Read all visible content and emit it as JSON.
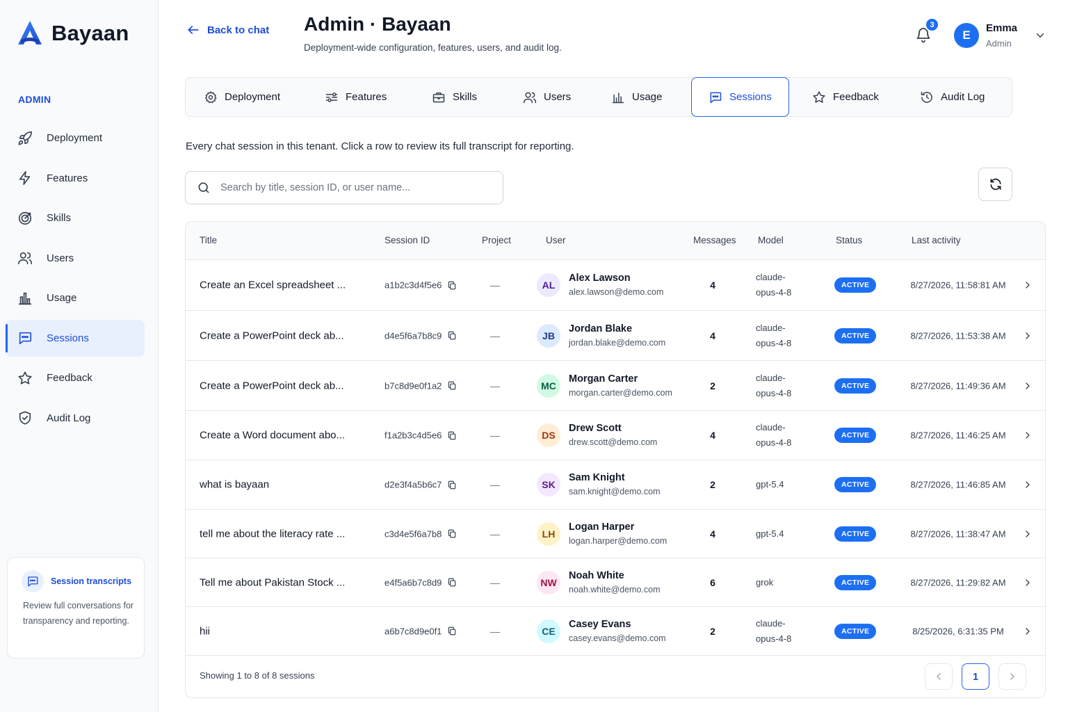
{
  "brand": {
    "name": "Bayaan"
  },
  "sidebar": {
    "section_label": "ADMIN",
    "items": [
      {
        "label": "Deployment",
        "icon": "rocket-icon"
      },
      {
        "label": "Features",
        "icon": "bolt-icon"
      },
      {
        "label": "Skills",
        "icon": "target-icon"
      },
      {
        "label": "Users",
        "icon": "users-icon"
      },
      {
        "label": "Usage",
        "icon": "bar-chart-icon"
      },
      {
        "label": "Sessions",
        "icon": "chat-bubble-icon",
        "active": true
      },
      {
        "label": "Feedback",
        "icon": "star-icon"
      },
      {
        "label": "Audit Log",
        "icon": "shield-check-icon"
      }
    ],
    "help": {
      "title": "Session transcripts",
      "body": "Review full conversations for transparency and reporting."
    }
  },
  "header": {
    "back_label": "Back to chat",
    "title": "Admin · Bayaan",
    "subtitle": "Deployment-wide configuration, features, users, and audit log.",
    "notifications": "3",
    "user": {
      "initial": "E",
      "name": "Emma",
      "role": "Admin"
    }
  },
  "tabs": [
    {
      "label": "Deployment",
      "icon": "gear-icon"
    },
    {
      "label": "Features",
      "icon": "sliders-icon"
    },
    {
      "label": "Skills",
      "icon": "briefcase-icon"
    },
    {
      "label": "Users",
      "icon": "users-icon"
    },
    {
      "label": "Usage",
      "icon": "bar-chart-icon"
    },
    {
      "label": "Sessions",
      "icon": "chat-bubble-icon",
      "active": true
    },
    {
      "label": "Feedback",
      "icon": "star-icon"
    },
    {
      "label": "Audit Log",
      "icon": "history-icon"
    }
  ],
  "main": {
    "intro": "Every chat session in this tenant. Click a row to review its full transcript for reporting.",
    "search_placeholder": "Search by title, session ID, or user name..."
  },
  "table": {
    "columns": [
      "Title",
      "Session ID",
      "Project",
      "User",
      "Messages",
      "Model",
      "Status",
      "Last activity"
    ],
    "rows": [
      {
        "title": "Create an Excel spreadsheet ...",
        "session_id": "a1b2c3d4f5e6",
        "project": "—",
        "initials": "AL",
        "name": "Alex Lawson",
        "email": "alex.lawson@demo.com",
        "messages": "4",
        "model": "claude-opus-4-8",
        "status": "ACTIVE",
        "last": "8/27/2026, 11:58:81 AM",
        "av_bg": "#ede9fe",
        "av_fg": "#4c1d95"
      },
      {
        "title": "Create a PowerPoint deck ab...",
        "session_id": "d4e5f6a7b8c9",
        "project": "—",
        "initials": "JB",
        "name": "Jordan Blake",
        "email": "jordan.blake@demo.com",
        "messages": "4",
        "model": "claude-opus-4-8",
        "status": "ACTIVE",
        "last": "8/27/2026, 11:53:38 AM",
        "av_bg": "#dbeafe",
        "av_fg": "#1e3a8a"
      },
      {
        "title": "Create a PowerPoint deck ab...",
        "session_id": "b7c8d9e0f1a2",
        "project": "—",
        "initials": "MC",
        "name": "Morgan Carter",
        "email": "morgan.carter@demo.com",
        "messages": "2",
        "model": "claude-opus-4-8",
        "status": "ACTIVE",
        "last": "8/27/2026, 11:49:36 AM",
        "av_bg": "#d1fae5",
        "av_fg": "#065f46"
      },
      {
        "title": "Create a Word document abo...",
        "session_id": "f1a2b3c4d5e6",
        "project": "—",
        "initials": "DS",
        "name": "Drew Scott",
        "email": "drew.scott@demo.com",
        "messages": "4",
        "model": "claude-opus-4-8",
        "status": "ACTIVE",
        "last": "8/27/2026, 11:46:25 AM",
        "av_bg": "#ffedd5",
        "av_fg": "#9a3412"
      },
      {
        "title": "what is bayaan",
        "session_id": "d2e3f4a5b6c7",
        "project": "—",
        "initials": "SK",
        "name": "Sam Knight",
        "email": "sam.knight@demo.com",
        "messages": "2",
        "model": "gpt-5.4",
        "status": "ACTIVE",
        "last": "8/27/2026, 11:46:85 AM",
        "av_bg": "#f3e8ff",
        "av_fg": "#581c87"
      },
      {
        "title": "tell me about the literacy rate ...",
        "session_id": "c3d4e5f6a7b8",
        "project": "—",
        "initials": "LH",
        "name": "Logan Harper",
        "email": "logan.harper@demo.com",
        "messages": "4",
        "model": "gpt-5.4",
        "status": "ACTIVE",
        "last": "8/27/2026, 11:38:47 AM",
        "av_bg": "#fef3c7",
        "av_fg": "#92400e"
      },
      {
        "title": "Tell me about Pakistan Stock ...",
        "session_id": "e4f5a6b7c8d9",
        "project": "—",
        "initials": "NW",
        "name": "Noah White",
        "email": "noah.white@demo.com",
        "messages": "6",
        "model": "grok",
        "status": "ACTIVE",
        "last": "8/27/2026, 11:29:82 AM",
        "av_bg": "#fce7f3",
        "av_fg": "#9d174d"
      },
      {
        "title": "hii",
        "session_id": "a6b7c8d9e0f1",
        "project": "—",
        "initials": "CE",
        "name": "Casey Evans",
        "email": "casey.evans@demo.com",
        "messages": "2",
        "model": "claude-opus-4-8",
        "status": "ACTIVE",
        "last": "8/25/2026, 6:31:35 PM",
        "av_bg": "#cffafe",
        "av_fg": "#155e75"
      }
    ]
  },
  "pagination": {
    "summary": "Showing 1 to 8 of 8 sessions",
    "current_page": "1"
  },
  "colors": {
    "accent": "#1d6ff2",
    "accent_dark": "#1d4ed8",
    "active_bg": "#e8f0fe"
  }
}
